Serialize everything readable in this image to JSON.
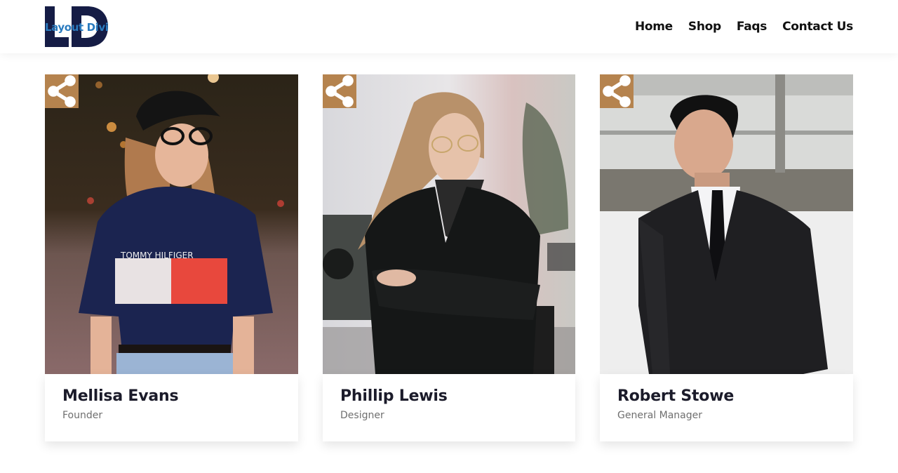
{
  "brand": {
    "logo_letters": "LD",
    "logo_text": "Layout Divi",
    "logo_dark_color": "#151c45",
    "logo_text_color": "#2a7bbf"
  },
  "nav": {
    "items": [
      {
        "label": "Home"
      },
      {
        "label": "Shop"
      },
      {
        "label": "Faqs"
      },
      {
        "label": "Contact Us"
      }
    ]
  },
  "team": {
    "accent_color": "#b5834e",
    "share_icon": "share-icon",
    "members": [
      {
        "name": "Mellisa Evans",
        "role": "Founder",
        "photo": "woman in cap, glasses and navy Tommy Hilfiger tee on a night street",
        "shirt_text": "TOMMY HILFIGER"
      },
      {
        "name": "Phillip Lewis",
        "role": "Designer",
        "photo": "woman in glasses and black leather jacket with arms crossed on a street"
      },
      {
        "name": "Robert Stowe",
        "role": "General Manager",
        "photo": "man in black suit and tie with hand in pocket"
      }
    ]
  }
}
